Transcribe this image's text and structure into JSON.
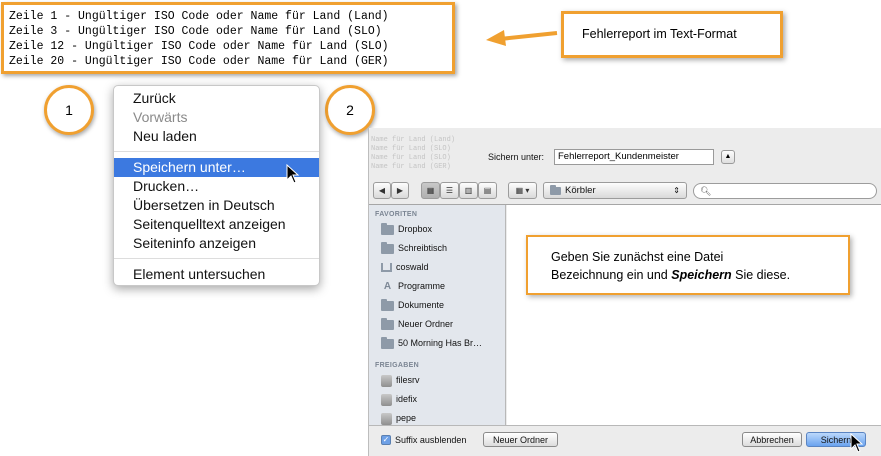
{
  "report": {
    "lines": [
      "Zeile 1 - Ungültiger ISO Code oder Name für Land (Land)",
      "Zeile 3 - Ungültiger ISO Code oder Name für Land (SLO)",
      "Zeile 12 - Ungültiger ISO Code oder Name für Land (SLO)",
      "Zeile 20 - Ungültiger ISO Code oder Name für Land (GER)"
    ]
  },
  "callout_top": "Fehlerreport im Text-Format",
  "steps": [
    "1",
    "2"
  ],
  "context_menu": {
    "items": [
      {
        "label": "Zurück",
        "state": "normal"
      },
      {
        "label": "Vorwärts",
        "state": "disabled"
      },
      {
        "label": "Neu laden",
        "state": "normal"
      },
      {
        "label": "Speichern unter…",
        "state": "selected"
      },
      {
        "label": "Drucken…",
        "state": "normal"
      },
      {
        "label": "Übersetzen in Deutsch",
        "state": "normal"
      },
      {
        "label": "Seitenquelltext anzeigen",
        "state": "normal"
      },
      {
        "label": "Seiteninfo anzeigen",
        "state": "normal"
      },
      {
        "label": "Element untersuchen",
        "state": "normal"
      }
    ]
  },
  "save_dialog": {
    "ghost_text": "Name für Land (Land)\nName für Land (SLO)\nName für Land (SLO)\nName für Land (GER)",
    "save_as_label": "Sichern unter:",
    "filename": "Fehlerreport_Kundenmeister",
    "location": "Körbler",
    "favorites_header": "FAVORITEN",
    "favorites": [
      {
        "label": "Dropbox",
        "icon": "folder-icon"
      },
      {
        "label": "Schreibtisch",
        "icon": "folder-icon"
      },
      {
        "label": "coswald",
        "icon": "home-icon"
      },
      {
        "label": "Programme",
        "icon": "applications-icon"
      },
      {
        "label": "Dokumente",
        "icon": "folder-icon"
      },
      {
        "label": "Neuer Ordner",
        "icon": "folder-icon"
      },
      {
        "label": "50 Morning Has Br…",
        "icon": "folder-icon"
      }
    ],
    "shared_header": "FREIGABEN",
    "shared": [
      {
        "label": "filesrv",
        "icon": "server-icon"
      },
      {
        "label": "idefix",
        "icon": "server-icon"
      },
      {
        "label": "pepe",
        "icon": "server-icon"
      }
    ],
    "callout": {
      "line1": "Geben Sie zunächst eine Datei",
      "line2_prefix": "Bezeichnung ein und ",
      "line2_bold": "Speichern",
      "line2_suffix": " Sie diese."
    },
    "hide_suffix_label": "Suffix ausblenden",
    "new_folder_label": "Neuer Ordner",
    "cancel_label": "Abbrechen",
    "save_label": "Sichern"
  },
  "colors": {
    "accent_orange": "#f0a030",
    "menu_highlight": "#3c79e0",
    "sidebar_bg": "#e3e7ed"
  }
}
